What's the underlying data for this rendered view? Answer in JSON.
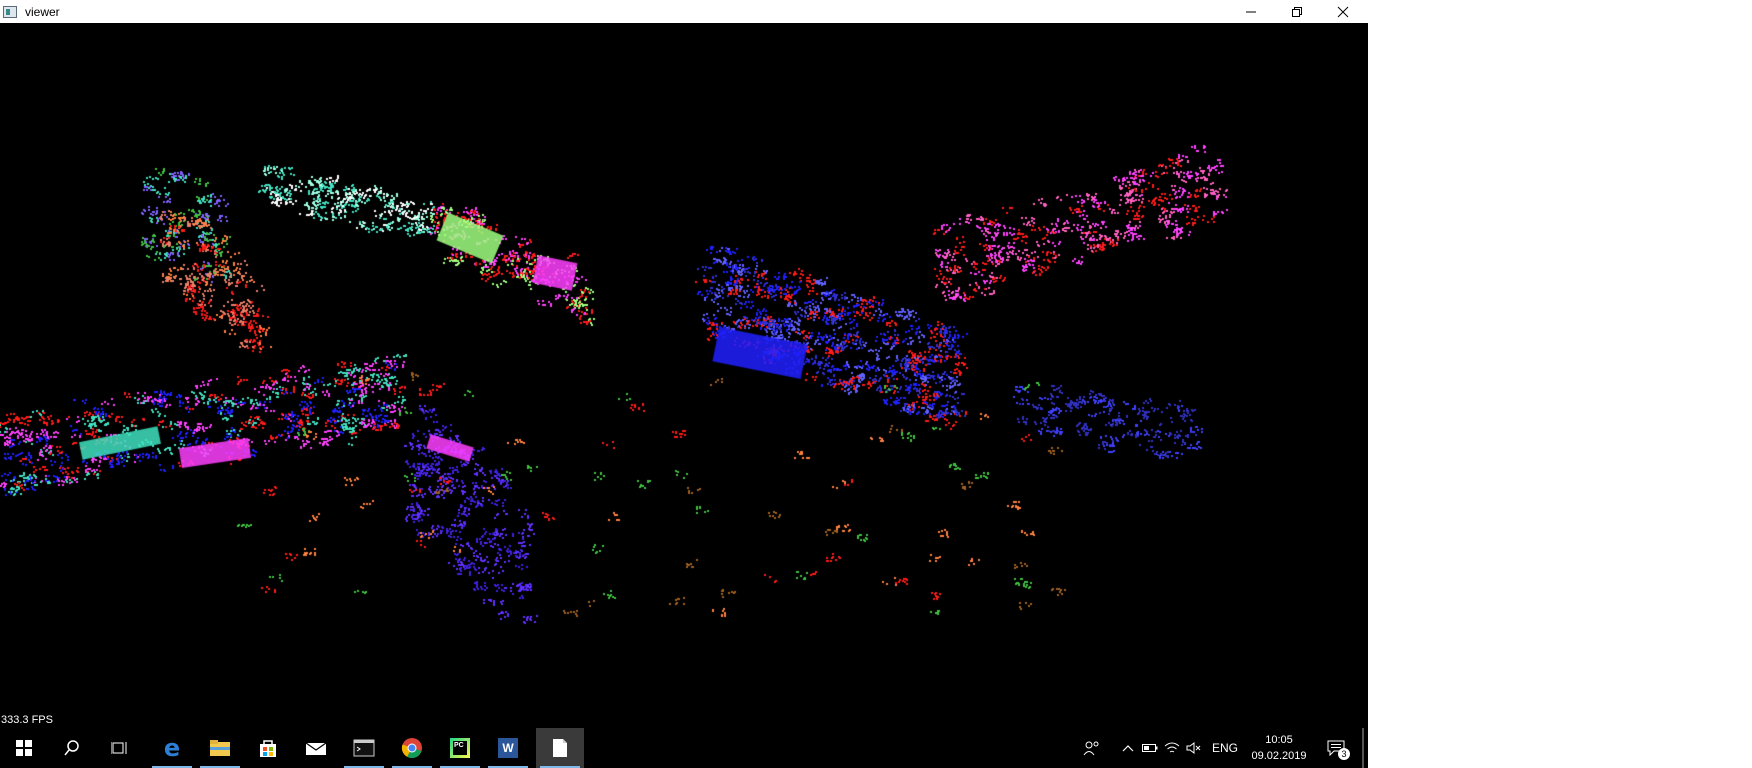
{
  "window": {
    "title": "viewer"
  },
  "viewer": {
    "fps_label": "333.3 FPS"
  },
  "taskbar": {
    "apps": [
      {
        "name": "start",
        "icon": "windows-logo-icon"
      },
      {
        "name": "search",
        "icon": "search-icon"
      },
      {
        "name": "task-view",
        "icon": "task-view-icon"
      },
      {
        "name": "edge",
        "icon": "edge-icon"
      },
      {
        "name": "file-explorer",
        "icon": "folder-icon"
      },
      {
        "name": "store",
        "icon": "store-icon"
      },
      {
        "name": "mail",
        "icon": "mail-icon"
      },
      {
        "name": "terminal",
        "icon": "terminal-icon"
      },
      {
        "name": "chrome",
        "icon": "chrome-icon"
      },
      {
        "name": "pycharm",
        "icon": "pycharm-icon",
        "label": "PC"
      },
      {
        "name": "word",
        "icon": "word-icon",
        "label": "W"
      },
      {
        "name": "viewer",
        "icon": "document-icon"
      }
    ],
    "tray": {
      "language": "ENG",
      "time": "10:05",
      "date": "09.02.2019",
      "notification_count": "3"
    }
  },
  "colors": {
    "background": "#000000",
    "taskbar": "#000000",
    "active_indicator": "#7db8e8",
    "point_palette": [
      "#ff1a1a",
      "#2020ff",
      "#ff40ff",
      "#40e0c0",
      "#a0ff40",
      "#ff8040",
      "#8060ff",
      "#e060e0",
      "#60c0ff",
      "#ffffff",
      "#40c040",
      "#c04040"
    ]
  },
  "point_clouds": [
    {
      "label": "left-poles",
      "colors": [
        "#40e0c0",
        "#8060ff",
        "#40c040"
      ],
      "count": 60
    },
    {
      "label": "left-wall",
      "colors": [
        "#ff8040",
        "#ff1a1a",
        "#e8806a"
      ],
      "count": 80
    },
    {
      "label": "top-wall",
      "colors": [
        "#40e0c0",
        "#a0ffe0",
        "#ffffff"
      ],
      "count": 90
    },
    {
      "label": "center-wall",
      "colors": [
        "#a0ff80",
        "#ff40ff",
        "#ff1a1a"
      ],
      "count": 90
    },
    {
      "label": "right-cloud-pink",
      "colors": [
        "#ff40ff",
        "#ff60c0",
        "#ff1a1a"
      ],
      "count": 160
    },
    {
      "label": "right-building-blue",
      "colors": [
        "#2020ff",
        "#3030d0",
        "#ff1a1a",
        "#6060ff"
      ],
      "count": 300
    },
    {
      "label": "left-cars",
      "colors": [
        "#ff1a1a",
        "#2020ff",
        "#ff40ff",
        "#40e0c0"
      ],
      "count": 260
    },
    {
      "label": "lower-blue",
      "colors": [
        "#4020e0",
        "#6030ff"
      ],
      "count": 120
    },
    {
      "label": "right-blue-floor",
      "colors": [
        "#4040ff",
        "#3030c0"
      ],
      "count": 70
    },
    {
      "label": "scattered",
      "colors": [
        "#ff8040",
        "#40c040",
        "#ff1a1a",
        "#a06020"
      ],
      "count": 90
    }
  ]
}
